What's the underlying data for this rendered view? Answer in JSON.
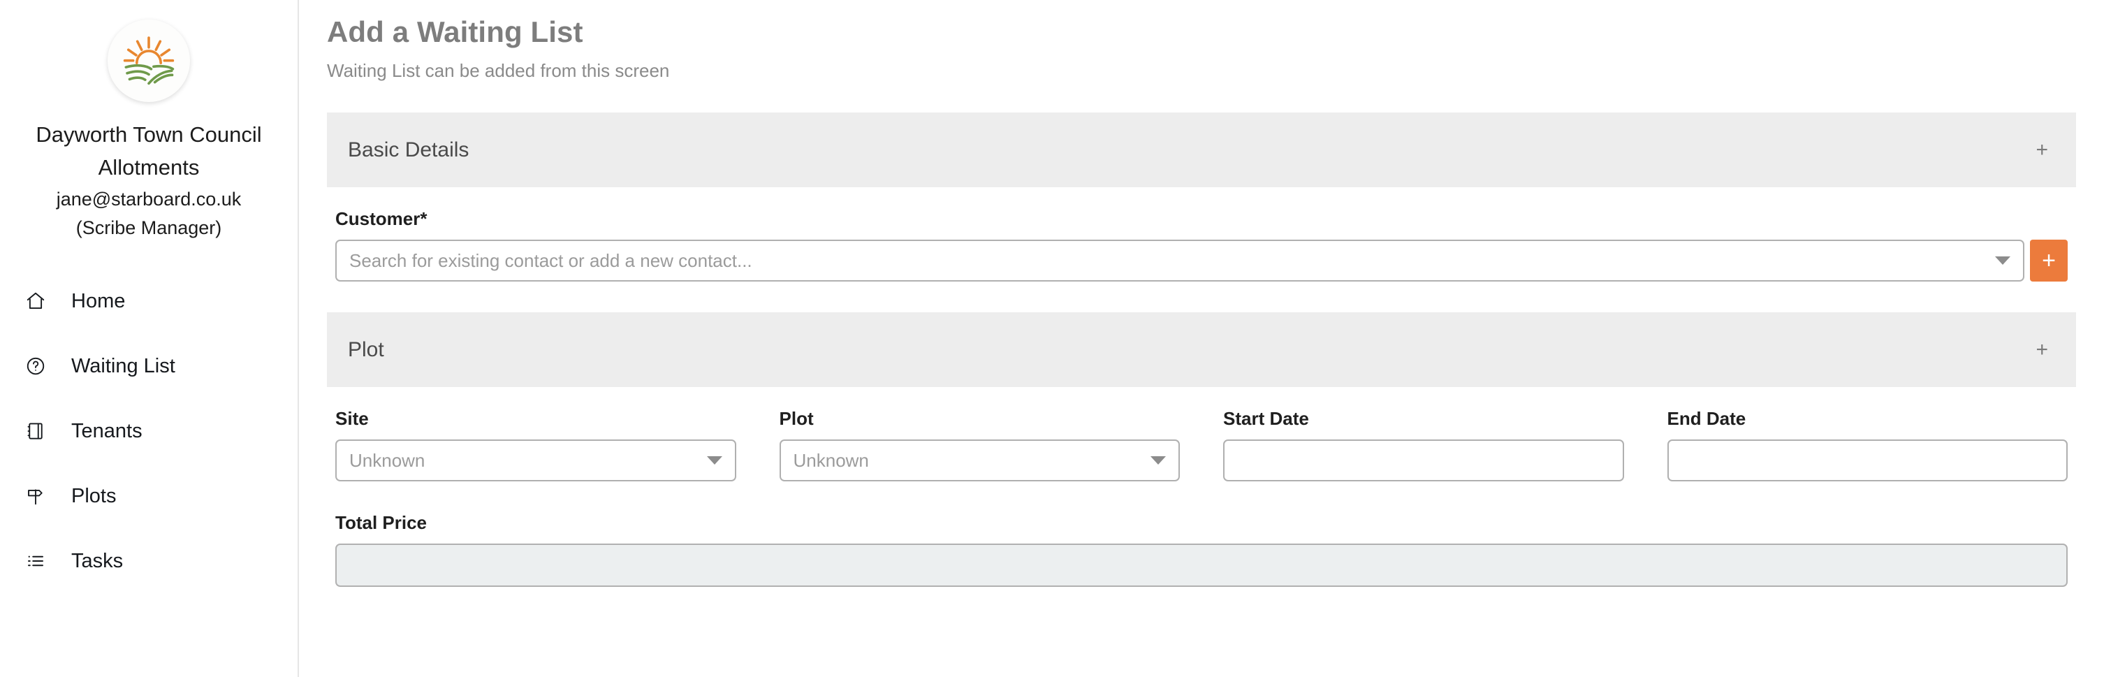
{
  "sidebar": {
    "logo_icon": "sunrise-field-logo",
    "org_name": "Dayworth Town Council",
    "org_subtitle": "Allotments",
    "user_email": "jane@starboard.co.uk",
    "user_role": "(Scribe Manager)",
    "items": [
      {
        "label": "Home",
        "icon": "home-icon"
      },
      {
        "label": "Waiting List",
        "icon": "question-circle-icon"
      },
      {
        "label": "Tenants",
        "icon": "notebook-icon"
      },
      {
        "label": "Plots",
        "icon": "signpost-icon"
      },
      {
        "label": "Tasks",
        "icon": "list-icon"
      }
    ]
  },
  "header": {
    "title": "Add a Waiting List",
    "subtitle": "Waiting List can be added from this screen"
  },
  "sections": {
    "basic_details": {
      "title": "Basic Details",
      "toggle": "+",
      "customer": {
        "label": "Customer*",
        "placeholder": "Search for existing contact or add a new contact...",
        "value": "",
        "add_button_label": "+"
      }
    },
    "plot": {
      "title": "Plot",
      "toggle": "+",
      "fields": {
        "site": {
          "label": "Site",
          "value": "Unknown"
        },
        "plot": {
          "label": "Plot",
          "value": "Unknown"
        },
        "start_date": {
          "label": "Start Date",
          "value": "",
          "placeholder": ""
        },
        "end_date": {
          "label": "End Date",
          "value": "",
          "placeholder": ""
        },
        "total_price": {
          "label": "Total Price",
          "value": "",
          "placeholder": ""
        }
      }
    }
  },
  "colors": {
    "accent_orange": "#ec7b3c",
    "section_grey": "#ededed",
    "readonly_fill": "#eceff0",
    "logo_sun": "#e8872f",
    "logo_field": "#6f9a4a"
  }
}
